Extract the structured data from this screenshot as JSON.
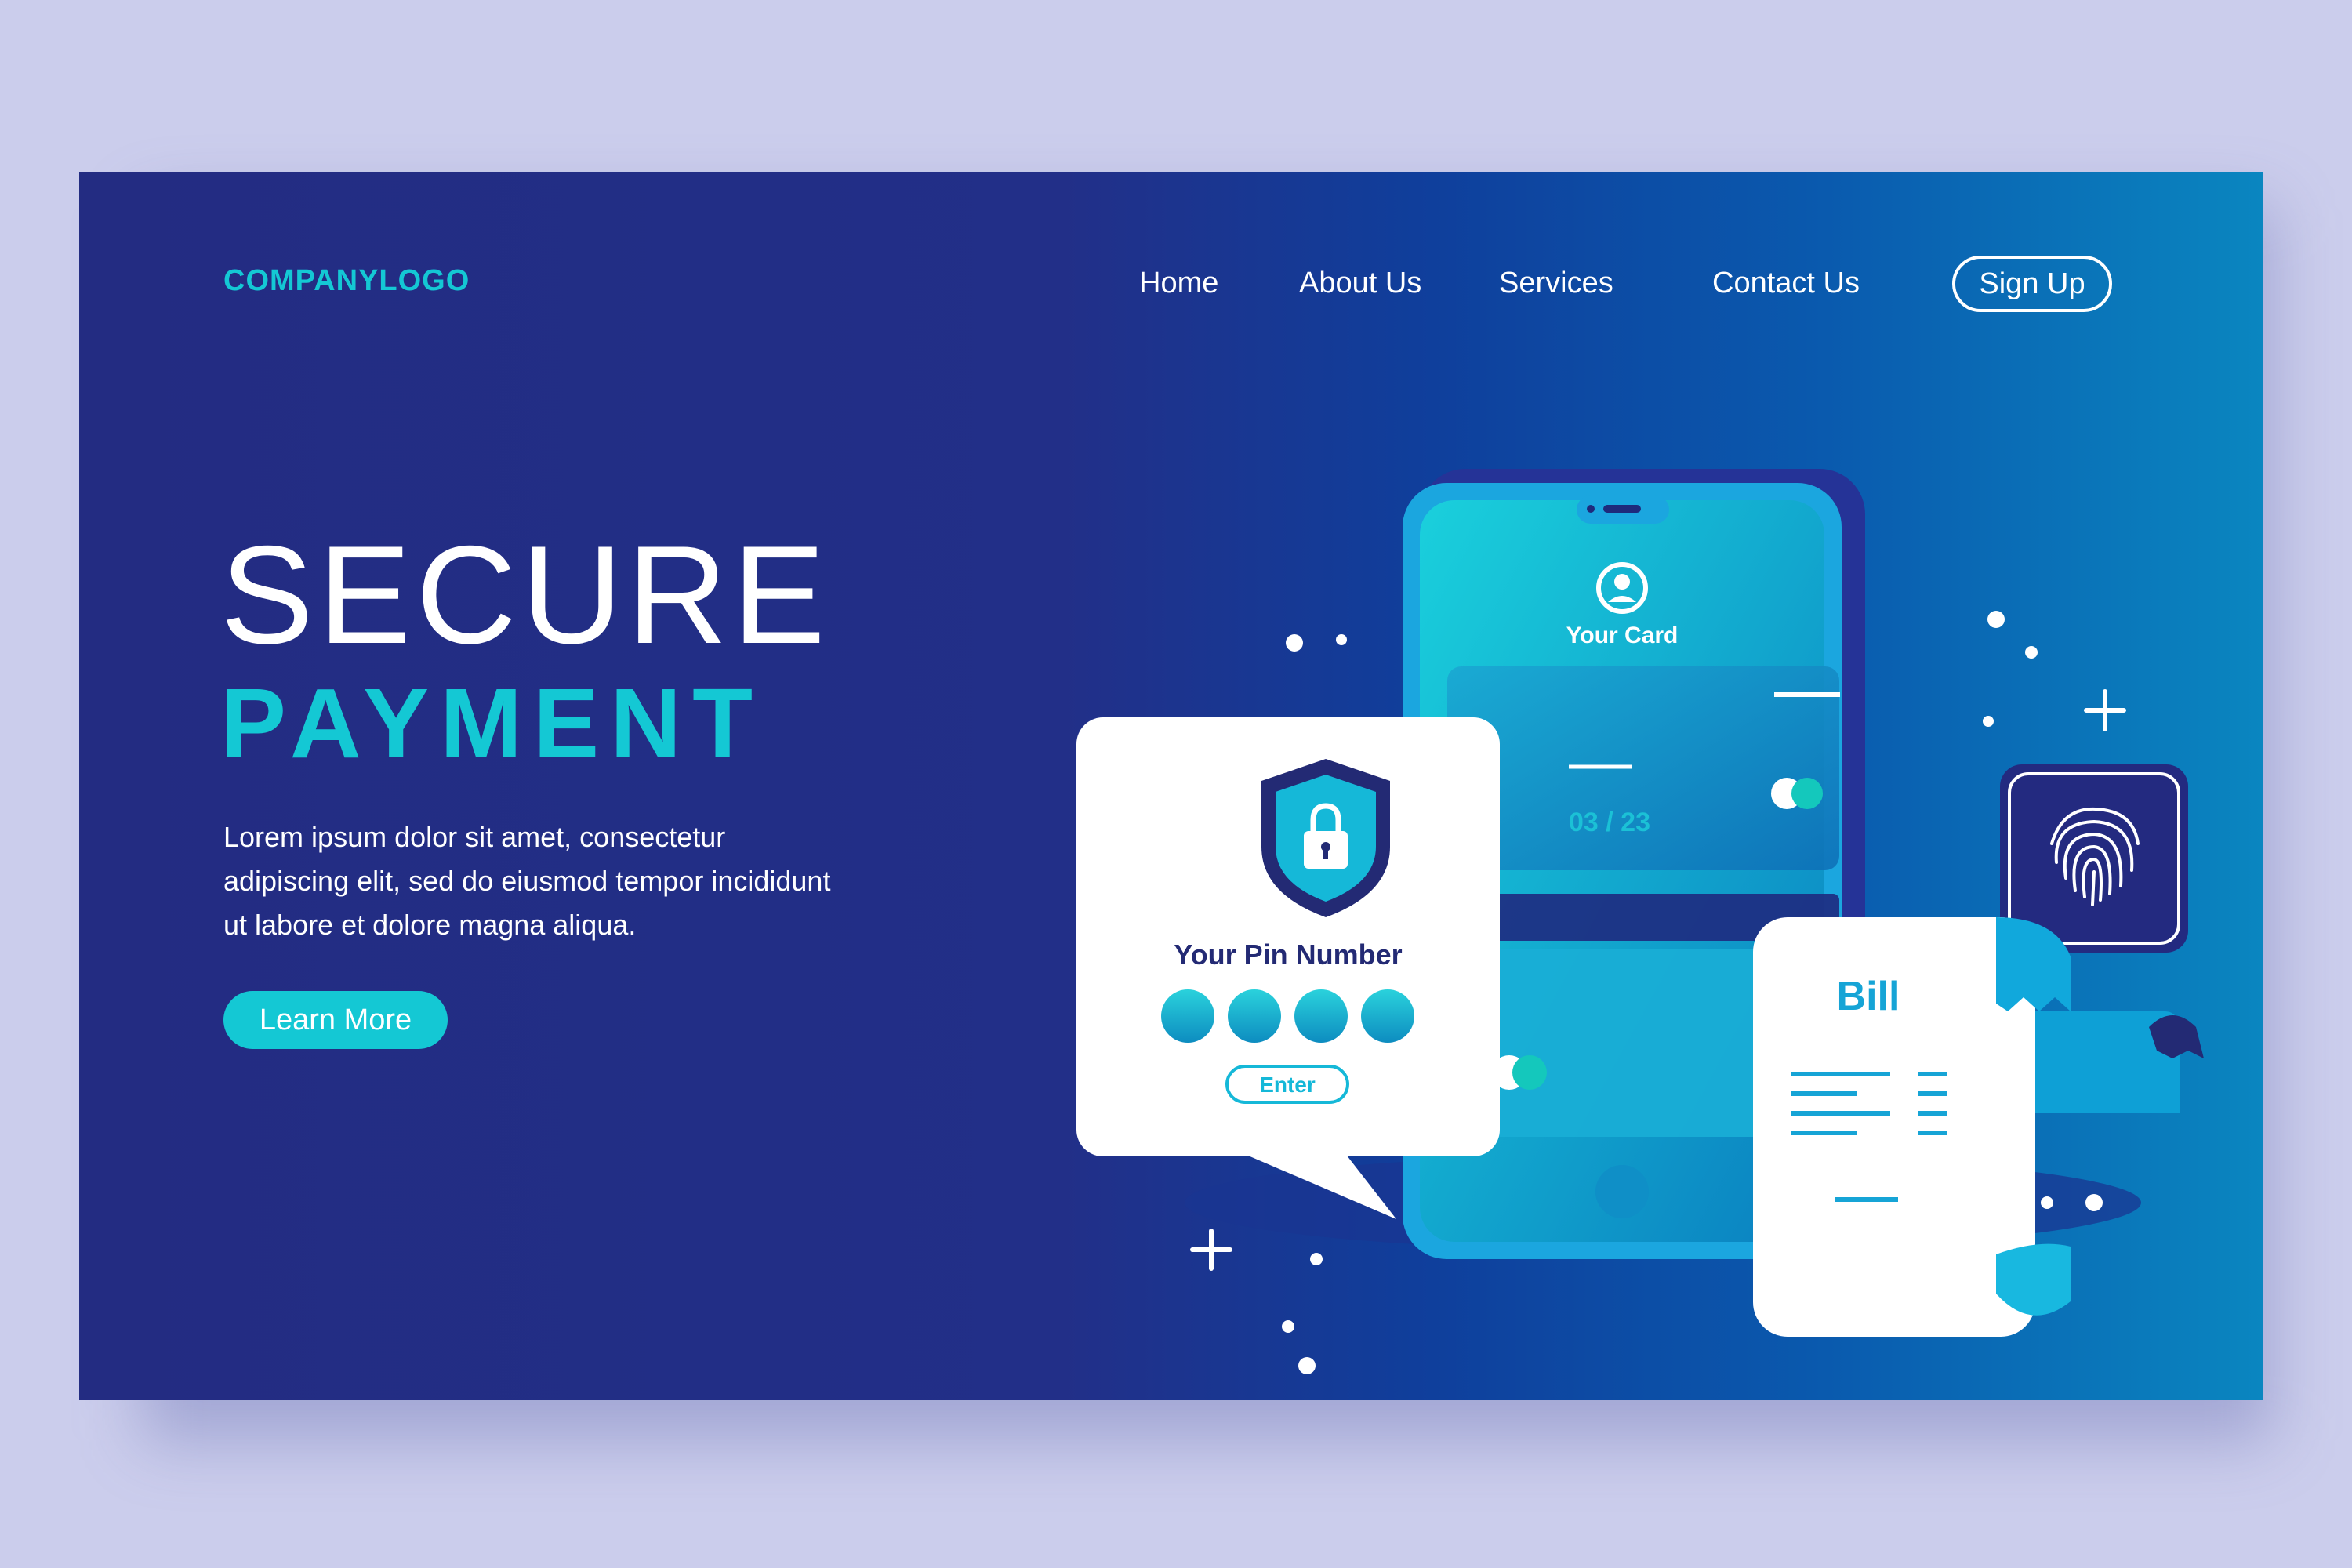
{
  "brand": {
    "logo_text": "COMPANYLOGO"
  },
  "nav": {
    "items": [
      {
        "label": "Home"
      },
      {
        "label": "About Us"
      },
      {
        "label": "Services"
      },
      {
        "label": "Contact Us"
      }
    ],
    "signup_label": "Sign Up"
  },
  "hero": {
    "title_line1": "SECURE",
    "title_line2": "PAYMENT",
    "body": "Lorem ipsum dolor sit amet, consectetur adipiscing elit, sed do eiusmod tempor incididunt ut labore et dolore magna aliqua.",
    "cta_label": "Learn More"
  },
  "illustration": {
    "phone": {
      "card_label": "Your Card",
      "card_expiry": "03 / 23"
    },
    "pin_dialog": {
      "title": "Your Pin Number",
      "pin_dots": 4,
      "enter_label": "Enter"
    },
    "bill": {
      "title": "Bill"
    }
  },
  "icons": [
    "user-icon",
    "padlock-shield-icon",
    "fingerprint-icon",
    "plus-sparkle-icon"
  ],
  "colors": {
    "accent": "#14c8d4",
    "bill_text": "#16a4d6",
    "pin_title": "#232a74",
    "background": "#cbcdec"
  }
}
